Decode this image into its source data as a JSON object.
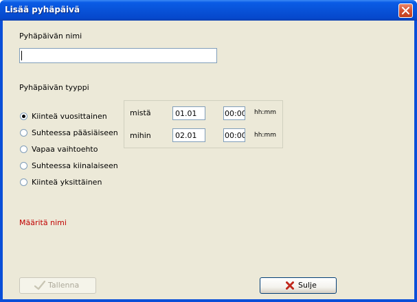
{
  "window": {
    "title": "Lisää pyhäpäivä"
  },
  "form": {
    "name_label": "Pyhäpäivän nimi",
    "name_value": "",
    "type_label": "Pyhäpäivän tyyppi",
    "types": [
      {
        "label": "Kiinteä vuosittainen",
        "checked": true
      },
      {
        "label": "Suhteessa pääsiäiseen",
        "checked": false
      },
      {
        "label": "Vapaa vaihtoehto",
        "checked": false
      },
      {
        "label": "Suhteessa kiinalaiseen",
        "checked": false
      },
      {
        "label": "Kiinteä yksittäinen",
        "checked": false
      }
    ],
    "range": {
      "from_label": "mistä",
      "from_date": "01.01",
      "from_time": "00:00",
      "to_label": "mihin",
      "to_date": "02.01",
      "to_time": "00:00",
      "time_format": "hh:mm"
    },
    "error": "Määritä nimi"
  },
  "buttons": {
    "save": {
      "label": "Tallenna",
      "icon": "check-icon",
      "enabled": false
    },
    "close": {
      "label": "Sulje",
      "icon": "x-icon",
      "enabled": true
    }
  },
  "colors": {
    "error": "#c00000",
    "title_bar": "#0852d8",
    "client": "#ece9d8",
    "close_icon": "#c0281c"
  }
}
